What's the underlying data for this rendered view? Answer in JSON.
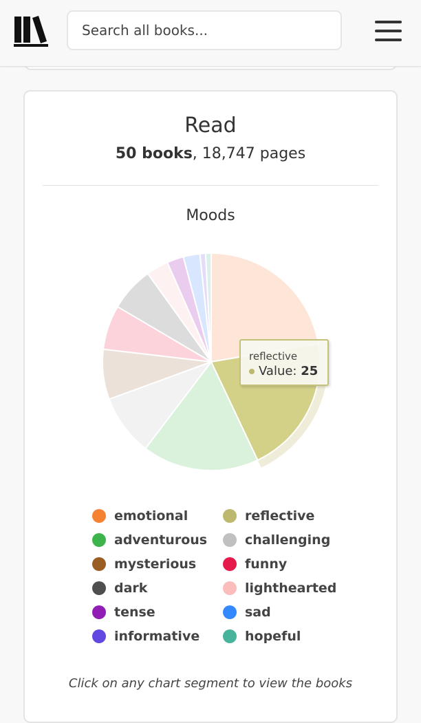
{
  "header": {
    "logo": "library-logo",
    "search_placeholder": "Search all books...",
    "menu": "hamburger-menu"
  },
  "card": {
    "title": "Read",
    "books_count": "50 books",
    "pages_count": ", 18,747 pages",
    "hint": "Click on any chart segment to view the books"
  },
  "tooltip": {
    "label": "reflective",
    "value_label": "Value: ",
    "value": "25"
  },
  "chart_data": {
    "type": "pie",
    "title": "Moods",
    "categories": [
      "emotional",
      "reflective",
      "adventurous",
      "challenging",
      "mysterious",
      "funny",
      "dark",
      "lighthearted",
      "tense",
      "sad",
      "informative",
      "hopeful"
    ],
    "values": [
      27,
      25,
      21,
      11,
      9,
      8,
      8,
      4,
      3,
      3,
      1,
      1
    ],
    "colors": [
      "#f58231",
      "#bcb86e",
      "#3cb44b",
      "#c0c0c0",
      "#9a5d24",
      "#e6194b",
      "#4f4f4f",
      "#fbbcbc",
      "#911eb4",
      "#3589ff",
      "#6247e0",
      "#46b39a"
    ],
    "faded_colors": [
      "#fde6d7",
      "#d3d088",
      "#daf1dc",
      "#f2f2f2",
      "#ebe1d8",
      "#fdd3db",
      "#dcdcdc",
      "#fef1f1",
      "#eaccef",
      "#d8e6ff",
      "#e3dcfa",
      "#daf0eb"
    ],
    "highlighted": "reflective",
    "legend_position": "bottom",
    "legend": [
      {
        "label": "emotional",
        "color": "#f58231"
      },
      {
        "label": "reflective",
        "color": "#bcb86e"
      },
      {
        "label": "adventurous",
        "color": "#3cb44b"
      },
      {
        "label": "challenging",
        "color": "#c0c0c0"
      },
      {
        "label": "mysterious",
        "color": "#9a5d24"
      },
      {
        "label": "funny",
        "color": "#e6194b"
      },
      {
        "label": "dark",
        "color": "#4f4f4f"
      },
      {
        "label": "lighthearted",
        "color": "#fbbcbc"
      },
      {
        "label": "tense",
        "color": "#911eb4"
      },
      {
        "label": "sad",
        "color": "#3589ff"
      },
      {
        "label": "informative",
        "color": "#6247e0"
      },
      {
        "label": "hopeful",
        "color": "#46b39a"
      }
    ]
  }
}
